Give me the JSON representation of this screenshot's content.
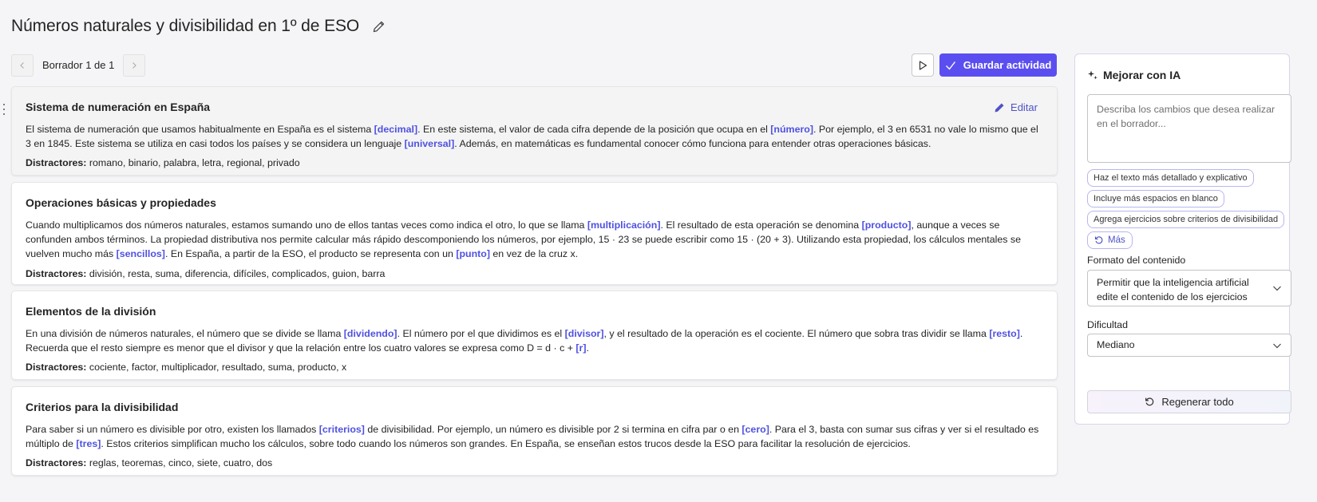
{
  "page": {
    "title": "Números naturales y divisibilidad en 1º de ESO"
  },
  "draft_nav": {
    "label": "Borrador 1 de 1"
  },
  "toolbar": {
    "save_label": "Guardar actividad"
  },
  "cards": [
    {
      "title": "Sistema de numeración en España",
      "edit_label": "Editar",
      "segments": [
        {
          "t": "El sistema de numeración que usamos habitualmente en España es el sistema "
        },
        {
          "t": "[decimal]",
          "blank": true
        },
        {
          "t": ". En este sistema, el valor de cada cifra depende de la posición que ocupa en el "
        },
        {
          "t": "[número]",
          "blank": true
        },
        {
          "t": ". Por ejemplo, el 3 en 6531 no vale lo mismo que el 3 en 1845. Este sistema se utiliza en casi todos los países y se considera un lenguaje "
        },
        {
          "t": "[universal]",
          "blank": true
        },
        {
          "t": ". Además, en matemáticas es fundamental conocer cómo funciona para entender otras operaciones básicas."
        }
      ],
      "distractors_label": "Distractores:",
      "distractors": " romano, binario, palabra, letra, regional, privado"
    },
    {
      "title": "Operaciones básicas y propiedades",
      "segments": [
        {
          "t": "Cuando multiplicamos dos números naturales, estamos sumando uno de ellos tantas veces como indica el otro, lo que se llama "
        },
        {
          "t": "[multiplicación]",
          "blank": true
        },
        {
          "t": ". El resultado de esta operación se denomina "
        },
        {
          "t": "[producto]",
          "blank": true
        },
        {
          "t": ", aunque a veces se confunden ambos términos. La propiedad distributiva nos permite calcular más rápido descomponiendo los números, por ejemplo, 15 · 23 se puede escribir como 15 · (20 + 3). Utilizando esta propiedad, los cálculos mentales se vuelven mucho más "
        },
        {
          "t": "[sencillos]",
          "blank": true
        },
        {
          "t": ". En España, a partir de la ESO, el producto se representa con un "
        },
        {
          "t": "[punto]",
          "blank": true
        },
        {
          "t": " en vez de la cruz x."
        }
      ],
      "distractors_label": "Distractores:",
      "distractors": " división, resta, suma, diferencia, difíciles, complicados, guion, barra"
    },
    {
      "title": "Elementos de la división",
      "segments": [
        {
          "t": "En una división de números naturales, el número que se divide se llama "
        },
        {
          "t": "[dividendo]",
          "blank": true
        },
        {
          "t": ". El número por el que dividimos es el "
        },
        {
          "t": "[divisor]",
          "blank": true
        },
        {
          "t": ", y el resultado de la operación es el cociente. El número que sobra tras dividir se llama "
        },
        {
          "t": "[resto]",
          "blank": true
        },
        {
          "t": ". Recuerda que el resto siempre es menor que el divisor y que la relación entre los cuatro valores se expresa como D = d · c + "
        },
        {
          "t": "[r]",
          "blank": true
        },
        {
          "t": "."
        }
      ],
      "distractors_label": "Distractores:",
      "distractors": " cociente, factor, multiplicador, resultado, suma, producto, x"
    },
    {
      "title": "Criterios para la divisibilidad",
      "segments": [
        {
          "t": "Para saber si un número es divisible por otro, existen los llamados "
        },
        {
          "t": "[criterios]",
          "blank": true
        },
        {
          "t": " de divisibilidad. Por ejemplo, un número es divisible por 2 si termina en cifra par o en "
        },
        {
          "t": "[cero]",
          "blank": true
        },
        {
          "t": ". Para el 3, basta con sumar sus cifras y ver si el resultado es múltiplo de "
        },
        {
          "t": "[tres]",
          "blank": true
        },
        {
          "t": ". Estos criterios simplifican mucho los cálculos, sobre todo cuando los números son grandes. En España, se enseñan estos trucos desde la ESO para facilitar la resolución de ejercicios."
        }
      ],
      "distractors_label": "Distractores:",
      "distractors": " reglas, teoremas, cinco, siete, cuatro, dos"
    }
  ],
  "side_panel": {
    "title": "Mejorar con IA",
    "prompt_placeholder": "Describa los cambios que desea realizar en el borrador...",
    "suggestions": [
      "Haz el texto más detallado y explicativo",
      "Incluye más espacios en blanco",
      "Agrega ejercicios sobre criterios de divisibilidad"
    ],
    "more_label": "Más",
    "format_label": "Formato del contenido",
    "format_value": "Permitir que la inteligencia artificial edite el contenido de los ejercicios",
    "difficulty_label": "Dificultad",
    "difficulty_value": "Mediano",
    "regen_label": "Regenerar todo"
  },
  "colors": {
    "accent": "#5b4ef0",
    "blank_text": "#4f52e0",
    "link": "#4f52c8"
  }
}
